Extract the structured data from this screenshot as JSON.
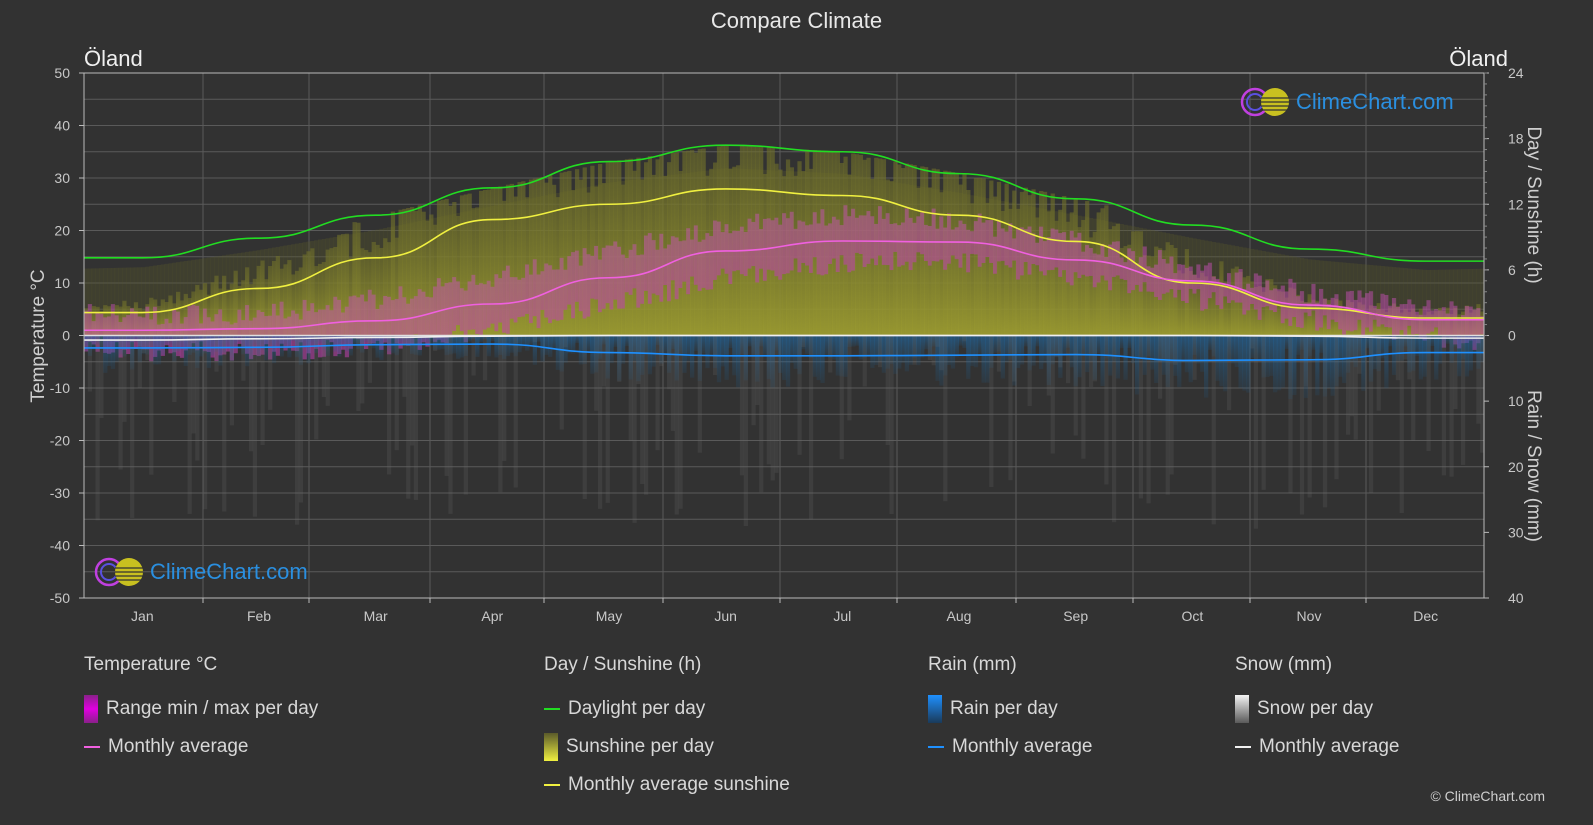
{
  "title": "Compare Climate",
  "location_left": "Öland",
  "location_right": "Öland",
  "logo_text": "ClimeChart.com",
  "copyright": "© ClimeChart.com",
  "colors": {
    "background": "#323232",
    "daylight": "#22dd22",
    "sunshine_line": "#f0f040",
    "sunshine_fill": "#9a9a2e",
    "temp_line": "#f060e0",
    "temp_fill": "#c040b0",
    "rain_line": "#1e90ff",
    "rain_fill": "#1f6fb0",
    "snow_line": "#f0f0f0",
    "snow_fill": "#8a8a8a",
    "logo_text": "#2a8fe0"
  },
  "legend": {
    "temperature": {
      "heading": "Temperature °C",
      "items": [
        {
          "label": "Range min / max per day",
          "type": "box",
          "color": "#e000e0"
        },
        {
          "label": "Monthly average",
          "type": "line",
          "color": "#f060e0"
        }
      ]
    },
    "sunshine": {
      "heading": "Day / Sunshine (h)",
      "items": [
        {
          "label": "Daylight per day",
          "type": "line",
          "color": "#22dd22"
        },
        {
          "label": "Sunshine per day",
          "type": "box",
          "color": "#e8e83a"
        },
        {
          "label": "Monthly average sunshine",
          "type": "line",
          "color": "#f0f040"
        }
      ]
    },
    "rain": {
      "heading": "Rain (mm)",
      "items": [
        {
          "label": "Rain per day",
          "type": "box",
          "color": "#1e90ff"
        },
        {
          "label": "Monthly average",
          "type": "line",
          "color": "#1e90ff"
        }
      ]
    },
    "snow": {
      "heading": "Snow (mm)",
      "items": [
        {
          "label": "Snow per day",
          "type": "box",
          "color": "#e8e8e8"
        },
        {
          "label": "Monthly average",
          "type": "line",
          "color": "#f0f0f0"
        }
      ]
    }
  },
  "chart_data": {
    "type": "line",
    "title": "Compare Climate",
    "categories": [
      "Jan",
      "Feb",
      "Mar",
      "Apr",
      "May",
      "Jun",
      "Jul",
      "Aug",
      "Sep",
      "Oct",
      "Nov",
      "Dec"
    ],
    "axes": {
      "left": {
        "label": "Temperature °C",
        "range": [
          -50,
          50
        ],
        "ticks": [
          50,
          40,
          30,
          20,
          10,
          0,
          -10,
          -20,
          -30,
          -40,
          -50
        ]
      },
      "right_top": {
        "label": "Day / Sunshine (h)",
        "range": [
          0,
          24
        ],
        "ticks": [
          24,
          18,
          12,
          6,
          0
        ]
      },
      "right_bottom": {
        "label": "Rain / Snow (mm)",
        "range": [
          0,
          40
        ],
        "ticks": [
          0,
          10,
          20,
          30,
          40
        ]
      }
    },
    "grid": true,
    "series": [
      {
        "name": "Daylight per day",
        "axis": "right_top",
        "unit": "h",
        "values": [
          7.1,
          8.9,
          11.0,
          13.5,
          15.9,
          17.4,
          16.8,
          14.8,
          12.5,
          10.1,
          7.9,
          6.8
        ]
      },
      {
        "name": "Monthly average sunshine",
        "axis": "right_top",
        "unit": "h",
        "values": [
          2.1,
          4.3,
          7.1,
          10.6,
          12.0,
          13.4,
          12.8,
          11.0,
          8.6,
          4.8,
          2.5,
          1.6
        ]
      },
      {
        "name": "Temperature monthly average",
        "axis": "left",
        "unit": "°C",
        "values": [
          1.0,
          1.3,
          2.8,
          6.0,
          11.0,
          16.1,
          18.0,
          17.8,
          14.4,
          10.4,
          5.8,
          3.0
        ]
      },
      {
        "name": "Temperature range max (approx)",
        "axis": "left",
        "unit": "°C",
        "values": [
          4,
          4,
          7,
          11,
          16,
          21,
          23,
          22,
          18,
          13,
          8,
          5
        ]
      },
      {
        "name": "Temperature range min (approx)",
        "axis": "left",
        "unit": "°C",
        "values": [
          -3,
          -3,
          -2,
          1,
          6,
          11,
          14,
          14,
          11,
          7,
          3,
          0
        ]
      },
      {
        "name": "Rain monthly average",
        "axis": "right_bottom",
        "unit": "mm",
        "values": [
          1.9,
          1.8,
          1.4,
          1.3,
          2.6,
          3.1,
          3.1,
          3.0,
          2.9,
          3.8,
          3.7,
          2.6
        ]
      },
      {
        "name": "Snow monthly average",
        "axis": "right_bottom",
        "unit": "mm",
        "values": [
          0.7,
          0.5,
          0.3,
          0.1,
          0.0,
          0.0,
          0.0,
          0.0,
          0.0,
          0.0,
          0.1,
          0.4
        ]
      }
    ]
  }
}
